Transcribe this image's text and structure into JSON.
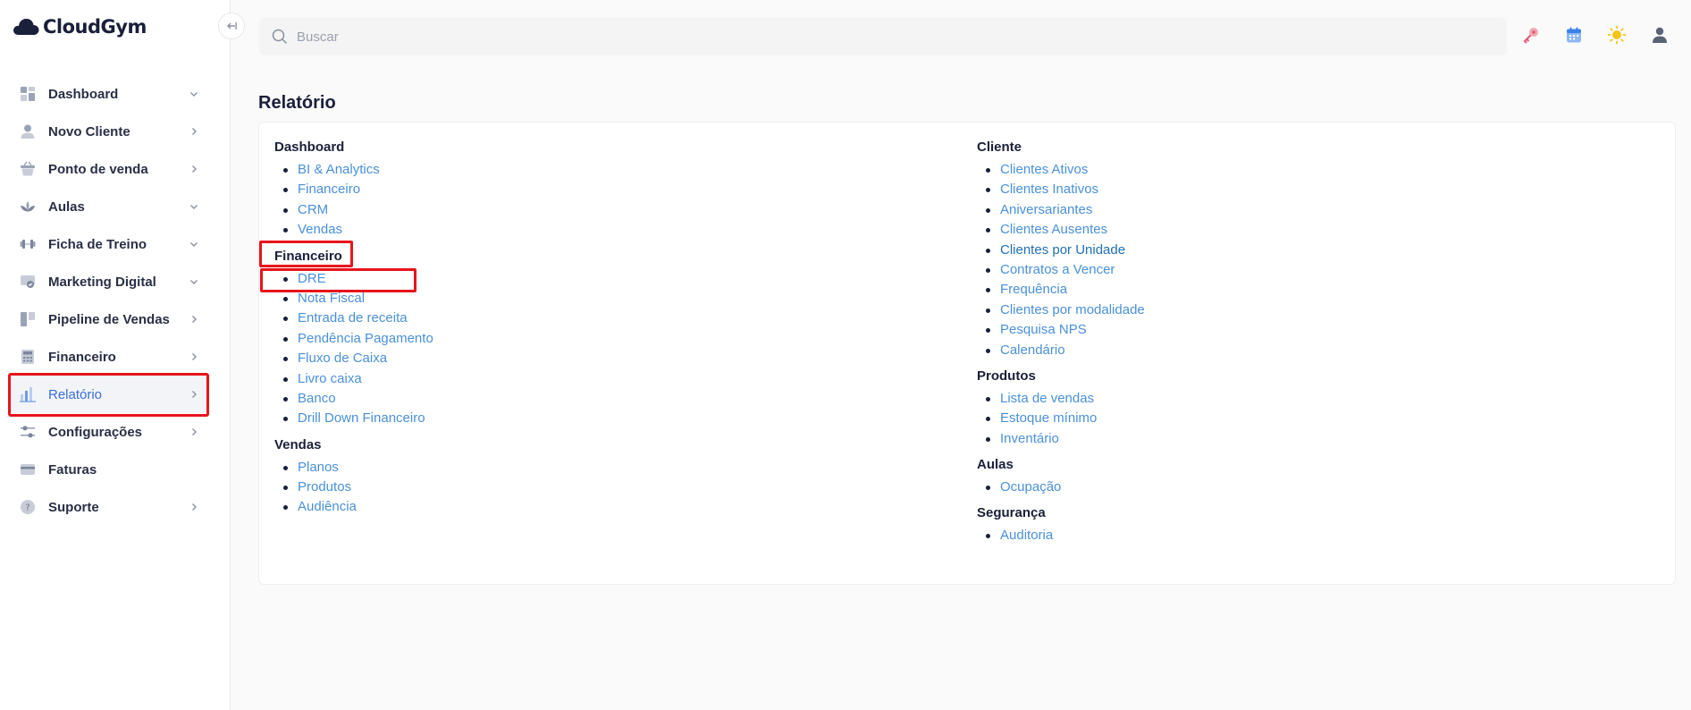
{
  "app": {
    "name": "CloudGym"
  },
  "search": {
    "placeholder": "Buscar"
  },
  "sidebar": {
    "items": [
      {
        "label": "Dashboard",
        "icon": "dashboard-icon",
        "chevron": "down"
      },
      {
        "label": "Novo Cliente",
        "icon": "user-icon",
        "chevron": "right"
      },
      {
        "label": "Ponto de venda",
        "icon": "basket-icon",
        "chevron": "right"
      },
      {
        "label": "Aulas",
        "icon": "lotus-icon",
        "chevron": "down"
      },
      {
        "label": "Ficha de Treino",
        "icon": "dumbbell-icon",
        "chevron": "down"
      },
      {
        "label": "Marketing Digital",
        "icon": "megaphone-icon",
        "chevron": "down"
      },
      {
        "label": "Pipeline de Vendas",
        "icon": "kanban-icon",
        "chevron": "right"
      },
      {
        "label": "Financeiro",
        "icon": "calculator-icon",
        "chevron": "right"
      },
      {
        "label": "Relatório",
        "icon": "bar-chart-icon",
        "chevron": "right",
        "active": true
      },
      {
        "label": "Configurações",
        "icon": "sliders-icon",
        "chevron": "right"
      },
      {
        "label": "Faturas",
        "icon": "credit-card-icon",
        "chevron": ""
      },
      {
        "label": "Suporte",
        "icon": "help-icon",
        "chevron": "right"
      }
    ]
  },
  "topbar": {
    "icons": [
      "key-icon",
      "calendar-icon",
      "sun-icon",
      "user-account-icon"
    ]
  },
  "page": {
    "title": "Relatório"
  },
  "report": {
    "left": [
      {
        "title": "Dashboard",
        "links": [
          "BI & Analytics",
          "Financeiro",
          "CRM",
          "Vendas"
        ]
      },
      {
        "title": "Financeiro",
        "links": [
          "DRE",
          "Nota Fiscal",
          "Entrada de receita",
          "Pendência Pagamento",
          "Fluxo de Caixa",
          "Livro caixa",
          "Banco",
          "Drill Down Financeiro"
        ]
      },
      {
        "title": "Vendas",
        "links": [
          "Planos",
          "Produtos",
          "Audiência"
        ]
      }
    ],
    "right": [
      {
        "title": "Cliente",
        "links": [
          "Clientes Ativos",
          "Clientes Inativos",
          "Aniversariantes",
          "Clientes Ausentes",
          "Clientes por Unidade",
          "Contratos a Vencer",
          "Frequência",
          "Clientes por modalidade",
          "Pesquisa NPS",
          "Calendário"
        ]
      },
      {
        "title": "Produtos",
        "links": [
          "Lista de vendas",
          "Estoque mínimo",
          "Inventário"
        ]
      },
      {
        "title": "Aulas",
        "links": [
          "Ocupação"
        ]
      },
      {
        "title": "Segurança",
        "links": [
          "Auditoria"
        ]
      }
    ]
  },
  "colors": {
    "accent": "#3a6fd8",
    "link": "#4a90d9",
    "highlight": "#e8141c"
  }
}
